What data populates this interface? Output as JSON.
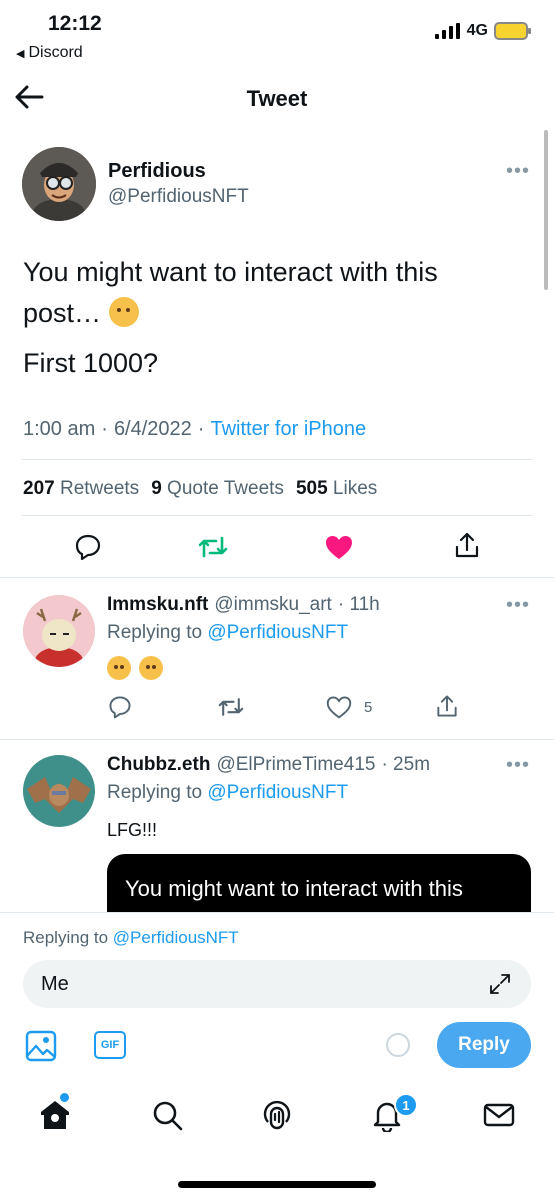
{
  "status_bar": {
    "time": "12:12",
    "back_app": "Discord",
    "network": "4G"
  },
  "header": {
    "title": "Tweet"
  },
  "tweet": {
    "author_name": "Perfidious",
    "author_handle": "@PerfidiousNFT",
    "more": "•••",
    "text_line1": "You might want to interact with this",
    "text_line2": "post…",
    "text_line3": "First 1000?",
    "time": "1:00 am",
    "date": "6/4/2022",
    "separator": "·",
    "source": "Twitter for iPhone",
    "retweets_count": "207",
    "retweets_label": "Retweets",
    "quotes_count": "9",
    "quotes_label": "Quote Tweets",
    "likes_count": "505",
    "likes_label": "Likes"
  },
  "replies": [
    {
      "name": "Immsku.nft",
      "handle": "@immsku_art",
      "time": "· 11h",
      "replying_prefix": "Replying to",
      "replying_to": "@PerfidiousNFT",
      "like_count": "5"
    },
    {
      "name": "Chubbz.eth",
      "handle": "@ElPrimeTime415",
      "time": "· 25m",
      "replying_prefix": "Replying to",
      "replying_to": "@PerfidiousNFT",
      "text": "LFG!!!",
      "quote_text": "You might want to interact with this"
    }
  ],
  "composer": {
    "replying_prefix": "Replying to",
    "replying_to": "@PerfidiousNFT",
    "input_value": "Me",
    "gif_label": "GIF",
    "reply_button": "Reply"
  },
  "tab_bar": {
    "notifications_badge": "1"
  },
  "colors": {
    "accent": "#1d9bf0",
    "like": "#f91880",
    "retweet_active": "#00ba7c"
  }
}
